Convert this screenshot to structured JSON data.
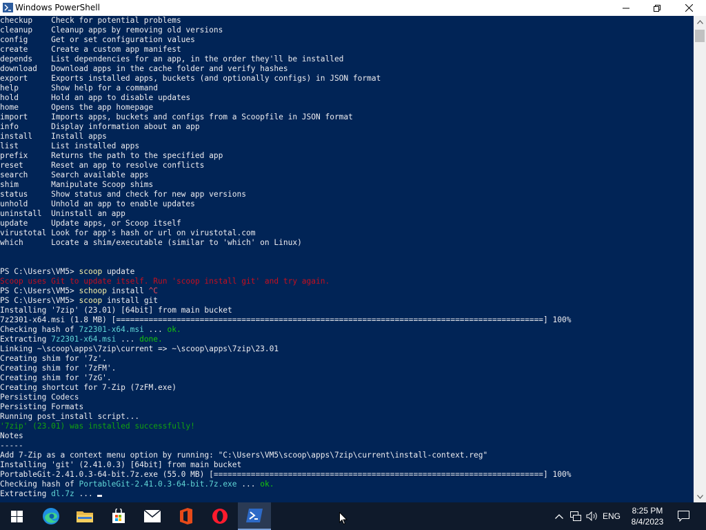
{
  "window": {
    "title": "Windows PowerShell",
    "controls": {
      "minimize": "minimize",
      "maximize": "maximize",
      "close": "close"
    }
  },
  "console": {
    "lines": [
      [
        [
          "checkup    Check for potential problems",
          "w"
        ]
      ],
      [
        [
          "cleanup    Cleanup apps by removing old versions",
          "w"
        ]
      ],
      [
        [
          "config     Get or set configuration values",
          "w"
        ]
      ],
      [
        [
          "create     Create a custom app manifest",
          "w"
        ]
      ],
      [
        [
          "depends    List dependencies for an app, in the order they'll be installed",
          "w"
        ]
      ],
      [
        [
          "download   Download apps in the cache folder and verify hashes",
          "w"
        ]
      ],
      [
        [
          "export     Exports installed apps, buckets (and optionally configs) in JSON format",
          "w"
        ]
      ],
      [
        [
          "help       Show help for a command",
          "w"
        ]
      ],
      [
        [
          "hold       Hold an app to disable updates",
          "w"
        ]
      ],
      [
        [
          "home       Opens the app homepage",
          "w"
        ]
      ],
      [
        [
          "import     Imports apps, buckets and configs from a Scoopfile in JSON format",
          "w"
        ]
      ],
      [
        [
          "info       Display information about an app",
          "w"
        ]
      ],
      [
        [
          "install    Install apps",
          "w"
        ]
      ],
      [
        [
          "list       List installed apps",
          "w"
        ]
      ],
      [
        [
          "prefix     Returns the path to the specified app",
          "w"
        ]
      ],
      [
        [
          "reset      Reset an app to resolve conflicts",
          "w"
        ]
      ],
      [
        [
          "search     Search available apps",
          "w"
        ]
      ],
      [
        [
          "shim       Manipulate Scoop shims",
          "w"
        ]
      ],
      [
        [
          "status     Show status and check for new app versions",
          "w"
        ]
      ],
      [
        [
          "unhold     Unhold an app to enable updates",
          "w"
        ]
      ],
      [
        [
          "uninstall  Uninstall an app",
          "w"
        ]
      ],
      [
        [
          "update     Update apps, or Scoop itself",
          "w"
        ]
      ],
      [
        [
          "virustotal Look for app's hash or url on virustotal.com",
          "w"
        ]
      ],
      [
        [
          "which      Locate a shim/executable (similar to 'which' on Linux)",
          "w"
        ]
      ],
      [],
      [],
      [
        [
          "PS C:\\Users\\VM5> ",
          "w"
        ],
        [
          "scoop",
          "y"
        ],
        [
          " update",
          "w"
        ]
      ],
      [
        [
          "Scoop uses Git to update itself. Run 'scoop install git' and try again.",
          "dr"
        ]
      ],
      [
        [
          "PS C:\\Users\\VM5> ",
          "w"
        ],
        [
          "schoop",
          "y"
        ],
        [
          " install ",
          "w"
        ],
        [
          "^C",
          "r"
        ]
      ],
      [
        [
          "PS C:\\Users\\VM5> ",
          "w"
        ],
        [
          "scoop",
          "y"
        ],
        [
          " install git",
          "w"
        ]
      ],
      [
        [
          "Installing '7zip' (23.01) [64bit] from main bucket",
          "w"
        ]
      ],
      [
        [
          "7z2301-x64.msi (1.8 MB) [============================================================================================] 100%",
          "w"
        ]
      ],
      [
        [
          "Checking hash of ",
          "w"
        ],
        [
          "7z2301-x64.msi",
          "cy"
        ],
        [
          " ... ",
          "w"
        ],
        [
          "ok.",
          "g"
        ]
      ],
      [
        [
          "Extracting ",
          "w"
        ],
        [
          "7z2301-x64.msi",
          "cy"
        ],
        [
          " ... ",
          "w"
        ],
        [
          "done.",
          "g"
        ]
      ],
      [
        [
          "Linking ~\\scoop\\apps\\7zip\\current => ~\\scoop\\apps\\7zip\\23.01",
          "w"
        ]
      ],
      [
        [
          "Creating shim for '7z'.",
          "w"
        ]
      ],
      [
        [
          "Creating shim for '7zFM'.",
          "w"
        ]
      ],
      [
        [
          "Creating shim for '7zG'.",
          "w"
        ]
      ],
      [
        [
          "Creating shortcut for 7-Zip (7zFM.exe)",
          "w"
        ]
      ],
      [
        [
          "Persisting Codecs",
          "w"
        ]
      ],
      [
        [
          "Persisting Formats",
          "w"
        ]
      ],
      [
        [
          "Running post_install script...",
          "w"
        ]
      ],
      [
        [
          "'7zip' (23.01) was installed successfully!",
          "dg"
        ]
      ],
      [
        [
          "Notes",
          "w"
        ]
      ],
      [
        [
          "-----",
          "w"
        ]
      ],
      [
        [
          "Add 7-Zip as a context menu option by running: \"C:\\Users\\VM5\\scoop\\apps\\7zip\\current\\install-context.reg\"",
          "w"
        ]
      ],
      [
        [
          "Installing 'git' (2.41.0.3) [64bit] from main bucket",
          "w"
        ]
      ],
      [
        [
          "PortableGit-2.41.0.3-64-bit.7z.exe (55.0 MB) [=======================================================================] 100%",
          "w"
        ]
      ],
      [
        [
          "Checking hash of ",
          "w"
        ],
        [
          "PortableGit-2.41.0.3-64-bit.7z.exe",
          "cy"
        ],
        [
          " ... ",
          "w"
        ],
        [
          "ok.",
          "g"
        ]
      ],
      [
        [
          "Extracting ",
          "w"
        ],
        [
          "dl.7z",
          "cy"
        ],
        [
          " ... ",
          "w"
        ]
      ]
    ]
  },
  "taskbar": {
    "items": [
      "start-button",
      "edge-icon",
      "file-explorer-icon",
      "store-icon",
      "mail-icon",
      "office-icon",
      "opera-icon",
      "powershell-icon"
    ],
    "tray": {
      "language": "ENG",
      "time": "8:25 PM",
      "date": "8/4/2023"
    }
  },
  "colors": {
    "console_bg": "#012456",
    "console_fg": "#eeedf0",
    "command_yellow": "#f9f1a5",
    "error_red": "#c50f1f",
    "accent_cyan": "#61d6d6",
    "ok_green": "#16c60c",
    "success_green": "#13a10e",
    "taskbar_bg": "#0f1a2b"
  }
}
